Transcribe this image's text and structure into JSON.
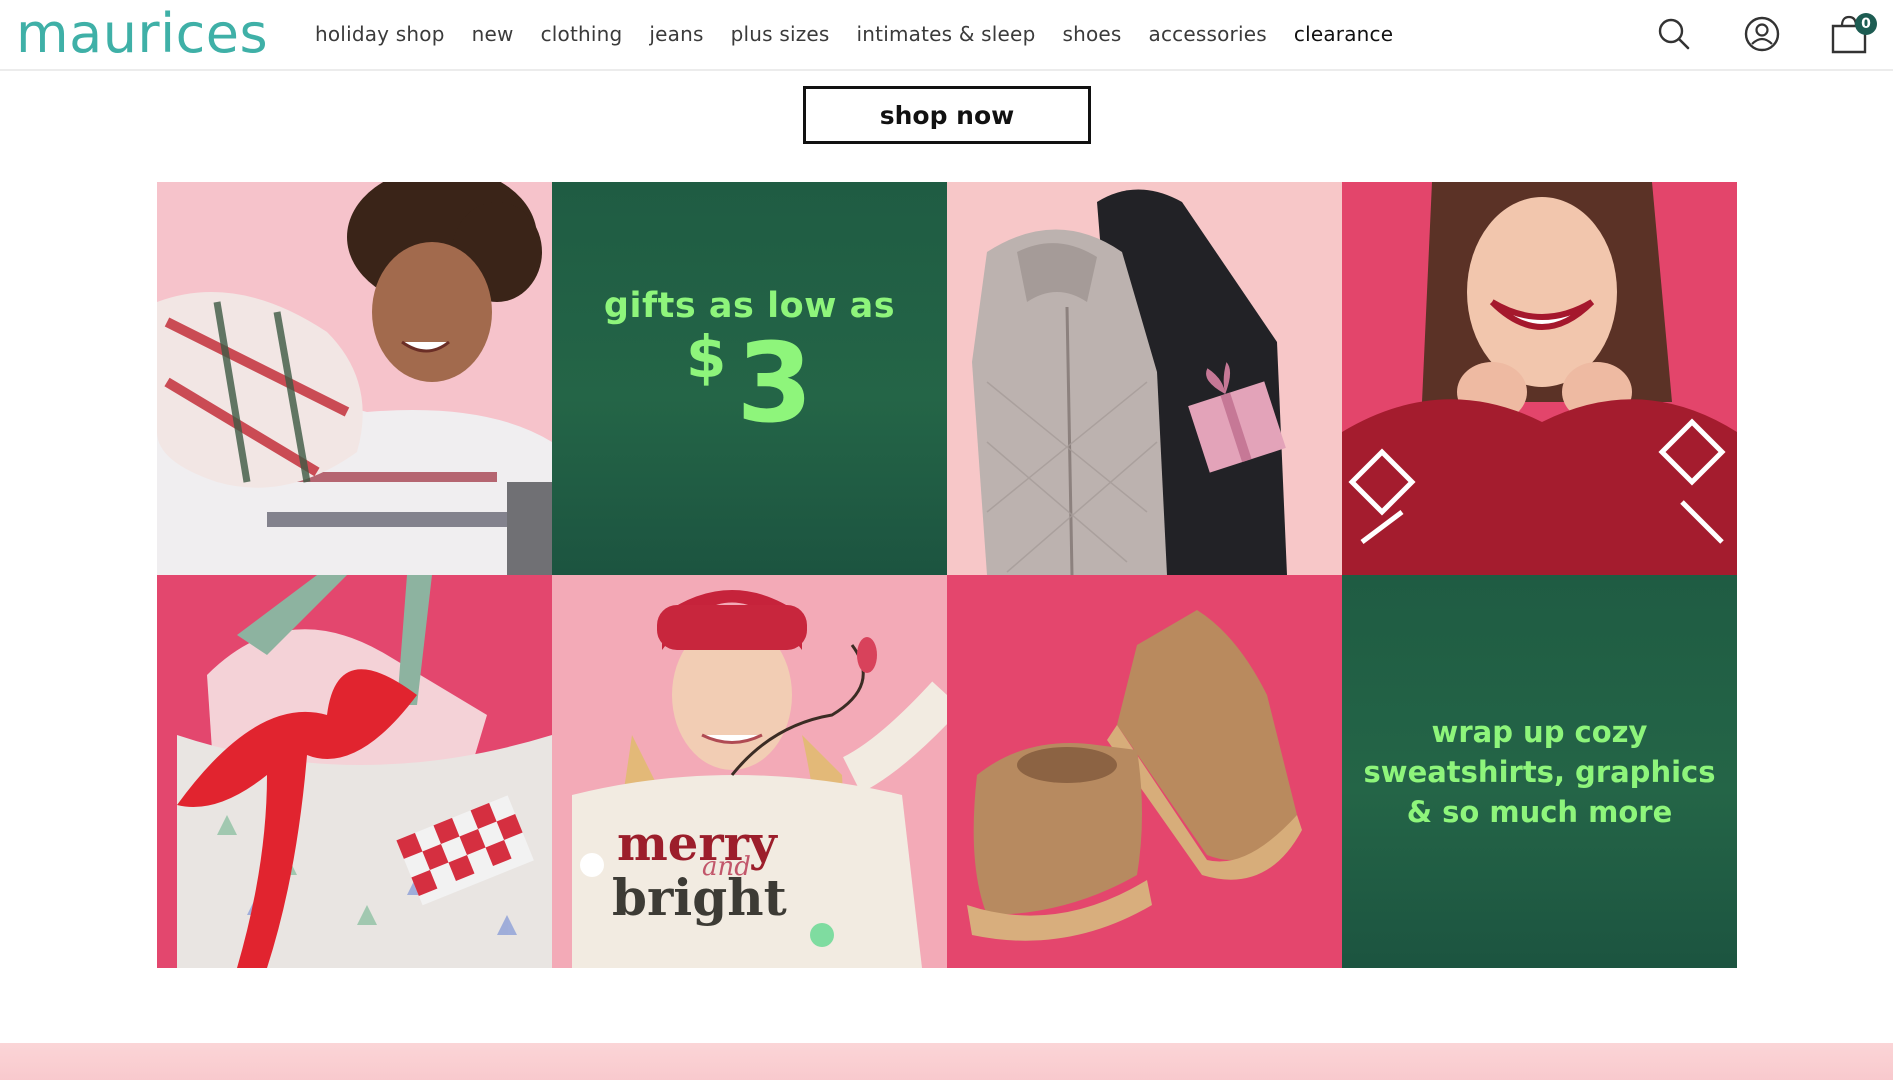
{
  "header": {
    "logo": "maurices",
    "nav": [
      {
        "label": "holiday shop"
      },
      {
        "label": "new"
      },
      {
        "label": "clothing"
      },
      {
        "label": "jeans"
      },
      {
        "label": "plus sizes"
      },
      {
        "label": "intimates & sleep"
      },
      {
        "label": "shoes"
      },
      {
        "label": "accessories"
      },
      {
        "label": "clearance"
      }
    ],
    "icons": {
      "search": "search-icon",
      "account": "account-icon",
      "cart": "cart-icon"
    },
    "cart_count": "0"
  },
  "hero": {
    "shop_now_label": "shop now"
  },
  "promos": {
    "gifts_line1": "gifts as low as",
    "gifts_currency": "$",
    "gifts_price": "3",
    "cozy_line1": "wrap up cozy",
    "cozy_line2": "sweatshirts, graphics",
    "cozy_line3": "& so much more"
  },
  "sweater_text": {
    "word1": "merry",
    "word2": "and",
    "word3": "bright"
  },
  "colors": {
    "brand_teal": "#3fb0a7",
    "promo_green": "#246547",
    "promo_text": "#8ef57b",
    "tile_pink": "#f6c6cb",
    "tile_hotpink": "#e8456d"
  }
}
